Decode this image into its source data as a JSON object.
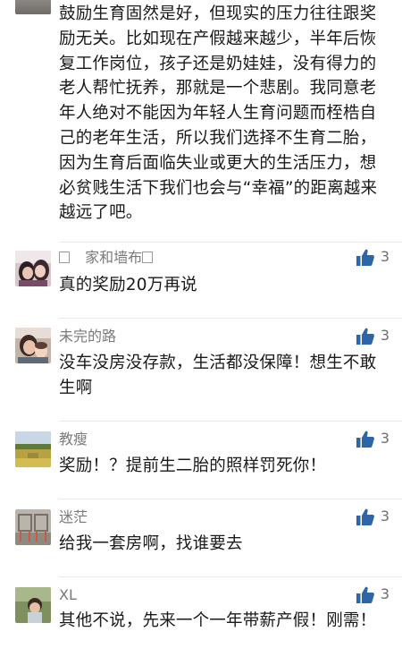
{
  "top_comment": {
    "text": "鼓励生育固然是好，但现实的压力往往跟奖励无关。比如现在产假越来越少，半年后恢复工作岗位，孩子还是奶娃娃，没有得力的老人帮忙抚养，那就是一个悲剧。我同意老年人绝对不能因为年轻人生育问题而桎梏自己的老年生活，所以我们选择不生育二胎，因为生育后面临失业或更大的生活压力，想必贫贱生活下我们也会与“幸福”的距离越来越远了吧。"
  },
  "comments": [
    {
      "username": "家和墙布",
      "content": "真的奖励20万再说",
      "likes": "3",
      "avatar": "photo-two-women"
    },
    {
      "username": "未完的路",
      "content": "没车没房没存款，生活都没保障！想生不敢生啊",
      "likes": "3",
      "avatar": "photo-mother-child"
    },
    {
      "username": "教瘦",
      "content": "奖励！？提前生二胎的照样罚死你！",
      "likes": "3",
      "avatar": "photo-field-landscape"
    },
    {
      "username": "迷茫",
      "content": "给我一套房啊，找谁要去",
      "likes": "3",
      "avatar": "photo-chairs"
    },
    {
      "username": "XL",
      "content": "其他不说，先来一个一年带薪产假！刚需！",
      "likes": "3",
      "avatar": "photo-child-outdoor"
    }
  ],
  "icons": {
    "like": "thumbs-up-icon"
  },
  "colors": {
    "like_icon": "#2d66a8",
    "username": "#7a7a7a",
    "text": "#1a1a1a"
  }
}
